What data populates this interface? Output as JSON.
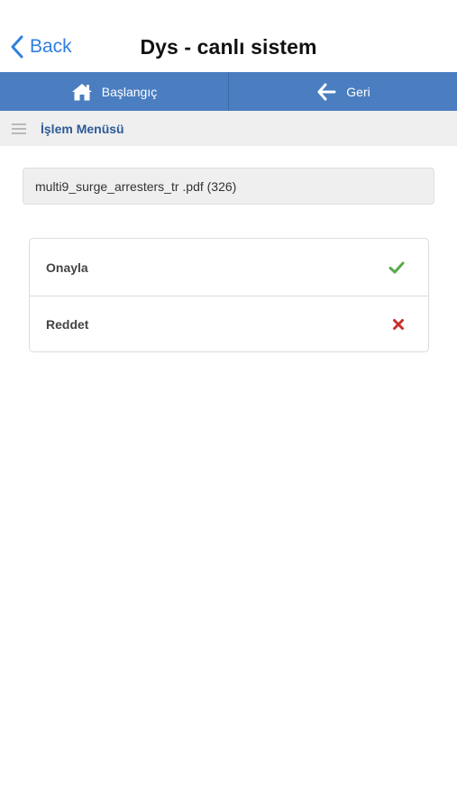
{
  "navbar": {
    "back_label": "Back",
    "title": "Dys - canlı sistem"
  },
  "toolbar": {
    "home_label": "Başlangıç",
    "back_label": "Geri"
  },
  "menu": {
    "title": "İşlem Menüsü"
  },
  "document": {
    "file_label": "multi9_surge_arresters_tr .pdf (326)"
  },
  "actions": [
    {
      "label": "Onayla",
      "icon": "check-icon",
      "color": "#5aaa4a"
    },
    {
      "label": "Reddet",
      "icon": "x-icon",
      "color": "#c9302c"
    }
  ],
  "colors": {
    "accent": "#2f7fde",
    "toolbar": "#4a7ec0",
    "menu_title": "#2d5a96"
  }
}
